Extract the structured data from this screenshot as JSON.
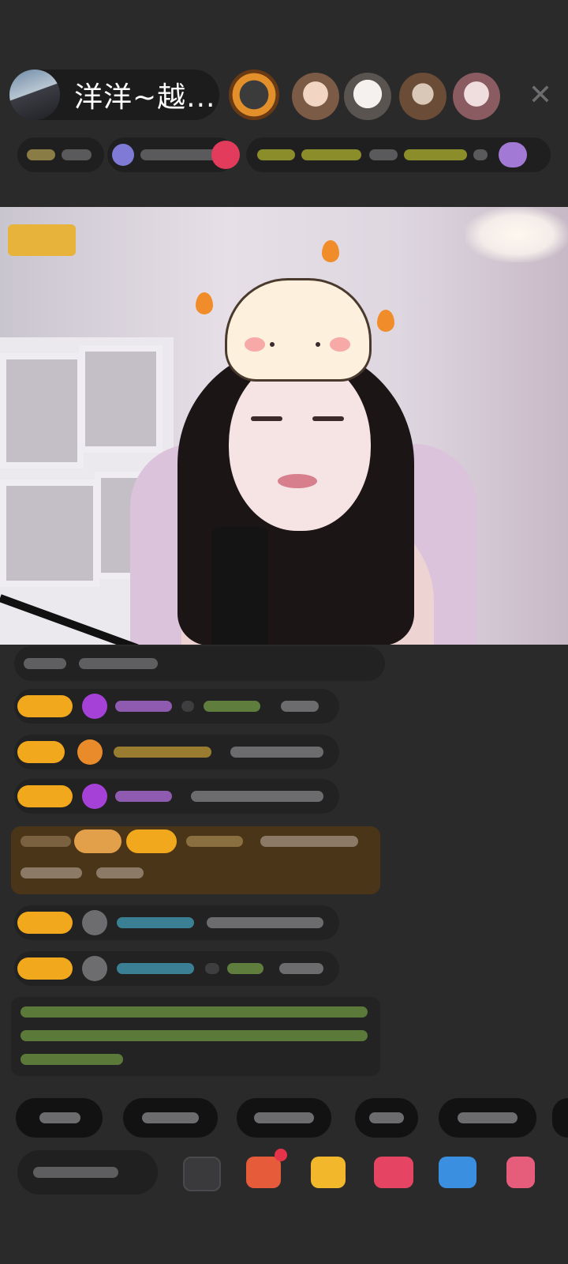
{
  "host": {
    "name": "洋洋~越...",
    "avatar_icon": "host-avatar"
  },
  "viewers": [
    {
      "icon": "viewer-avatar-1",
      "color": "#c9832a"
    },
    {
      "icon": "viewer-avatar-2",
      "color": "#b98b74"
    },
    {
      "icon": "viewer-avatar-3",
      "color": "#d8d0c8"
    },
    {
      "icon": "viewer-avatar-4",
      "color": "#8c6a52"
    },
    {
      "icon": "viewer-avatar-5",
      "color": "#d9b3b3"
    }
  ],
  "close_icon": "close-icon",
  "close_glyph": "✕",
  "video_badge": "",
  "chat": {
    "bar_gold": "#f2a81c",
    "name_purple": "#b57ad9",
    "name_green": "#7aa854",
    "name_yellow": "#c9a23d",
    "name_cyan": "#3ea6c4",
    "text_gray": "#8c8c8e"
  },
  "quick_replies": [
    "",
    "",
    "",
    "",
    ""
  ],
  "bottom_bar": {
    "input_placeholder": "",
    "icons": [
      "emoji-icon",
      "gift-box-icon",
      "fries-icon",
      "heart-pack-icon",
      "game-icon",
      "more-icon"
    ]
  }
}
